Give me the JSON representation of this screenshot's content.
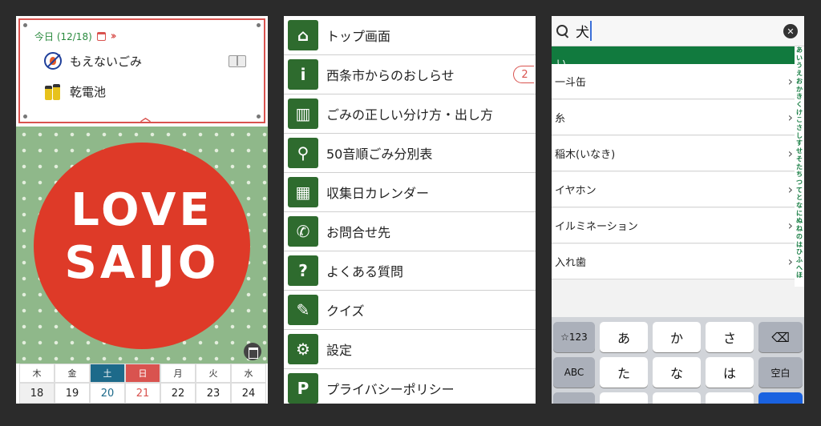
{
  "panel1": {
    "today_label": "今日 (12/18)",
    "items": [
      {
        "label": "もえないごみ",
        "icon": "no-burn-icon"
      },
      {
        "label": "乾電池",
        "icon": "battery-icon"
      }
    ],
    "logo_line1": "LOVE",
    "logo_line2": "SAIJO",
    "week": {
      "days": [
        "木",
        "金",
        "土",
        "日",
        "月",
        "火",
        "水"
      ],
      "dates": [
        "18",
        "19",
        "20",
        "21",
        "22",
        "23",
        "24"
      ]
    },
    "colors": {
      "accent_red": "#d9534f",
      "green": "#2a8a3e",
      "sat_blue": "#1d6a8a"
    }
  },
  "panel2": {
    "menu": [
      {
        "label": "トップ画面",
        "icon": "home-icon",
        "glyph": "⌂"
      },
      {
        "label": "西条市からのおしらせ",
        "icon": "info-bubble-icon",
        "glyph": "i",
        "badge": "2"
      },
      {
        "label": "ごみの正しい分け方・出し方",
        "icon": "book-icon",
        "glyph": "▥"
      },
      {
        "label": "50音順ごみ分別表",
        "icon": "search-icon",
        "glyph": "⚲"
      },
      {
        "label": "収集日カレンダー",
        "icon": "calendar-icon",
        "glyph": "▦"
      },
      {
        "label": "お問合せ先",
        "icon": "phone-icon",
        "glyph": "✆"
      },
      {
        "label": "よくある質問",
        "icon": "question-icon",
        "glyph": "?"
      },
      {
        "label": "クイズ",
        "icon": "pencil-icon",
        "glyph": "✎"
      },
      {
        "label": "設定",
        "icon": "gear-icon",
        "glyph": "⚙"
      },
      {
        "label": "プライバシーポリシー",
        "icon": "p-icon",
        "glyph": "P"
      }
    ]
  },
  "panel3": {
    "search_value": "犬",
    "group_header": "い",
    "results": [
      "一斗缶",
      "糸",
      "稲木(いなき)",
      "イヤホン",
      "イルミネーション",
      "入れ歯"
    ],
    "index": [
      "あ",
      "い",
      "う",
      "え",
      "お",
      "か",
      "き",
      "く",
      "け",
      "こ",
      "さ",
      "し",
      "す",
      "せ",
      "そ",
      "た",
      "ち",
      "つ",
      "て",
      "と",
      "な",
      "に",
      "ぬ",
      "ね",
      "の",
      "は",
      "ひ",
      "ふ",
      "へ",
      "ほ"
    ],
    "keys": {
      "num": "☆123",
      "abc": "ABC",
      "a": "あ",
      "ka": "か",
      "sa": "さ",
      "ta": "た",
      "na": "な",
      "ha": "は",
      "space": "空白"
    }
  }
}
